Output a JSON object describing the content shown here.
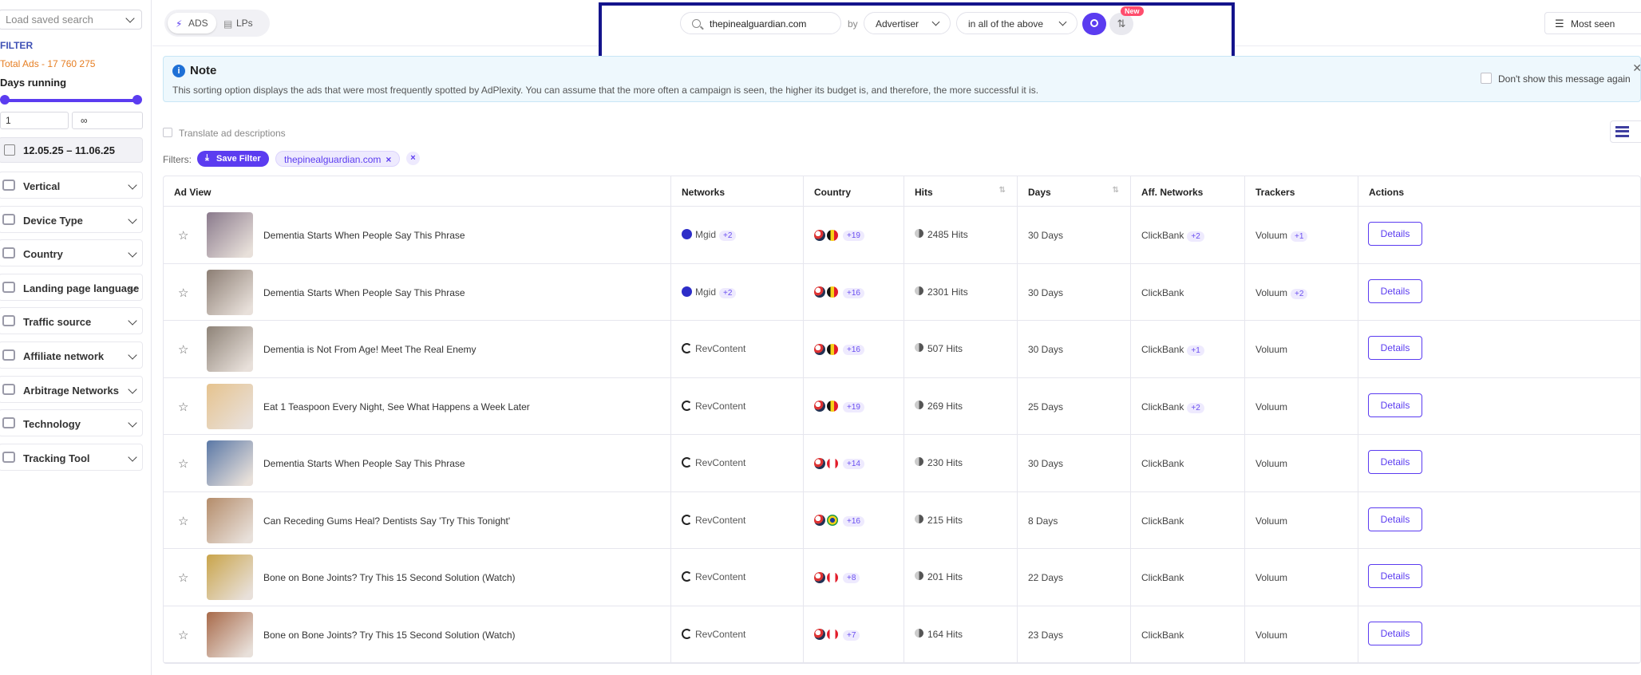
{
  "sidebar": {
    "saved_search_placeholder": "Load saved search",
    "filter_title": "FILTER",
    "total_ads": "Total Ads - 17 760 275",
    "days_running_label": "Days running",
    "days_min": "1",
    "days_max": "∞",
    "date_range": "12.05.25 – 11.06.25",
    "sections": [
      {
        "label": "Vertical",
        "icon": "vertical-icon"
      },
      {
        "label": "Device Type",
        "icon": "device-icon"
      },
      {
        "label": "Country",
        "icon": "globe-icon"
      },
      {
        "label": "Landing page language",
        "icon": "language-icon"
      },
      {
        "label": "Traffic source",
        "icon": "traffic-icon"
      },
      {
        "label": "Affiliate network",
        "icon": "affiliate-icon"
      },
      {
        "label": "Arbitrage Networks",
        "icon": "arbitrage-icon"
      },
      {
        "label": "Technology",
        "icon": "technology-icon"
      },
      {
        "label": "Tracking Tool",
        "icon": "tracking-icon"
      }
    ]
  },
  "topbar": {
    "toggle": {
      "ads": "ADS",
      "lps": "LPs"
    },
    "search_value": "thepinealguardian.com",
    "by_label": "by",
    "search_by": "Advertiser",
    "search_scope": "in all of the above",
    "new_badge": "New",
    "sort": "Most seen"
  },
  "note": {
    "title": "Note",
    "text": "This sorting option displays the ads that were most frequently spotted by AdPlexity. You can assume that the more often a campaign is seen, the higher its budget is, and therefore, the more successful it is.",
    "dont_show": "Don't show this message again"
  },
  "filters": {
    "translate_label": "Translate ad descriptions",
    "label": "Filters:",
    "save_filter": "Save Filter",
    "active": [
      "thepinealguardian.com"
    ]
  },
  "table": {
    "headers": [
      "Ad View",
      "Networks",
      "Country",
      "Hits",
      "Days",
      "Aff. Networks",
      "Trackers",
      "Actions"
    ],
    "details_label": "Details",
    "rows": [
      {
        "title": "Dementia Starts When People Say This Phrase",
        "network": "Mgid",
        "network_extra": "+2",
        "flags": [
          "us",
          "be"
        ],
        "country_extra": "+19",
        "hits": "2485 Hits",
        "days": "30 Days",
        "aff": "ClickBank",
        "aff_extra": "+2",
        "tracker": "Voluum",
        "tracker_extra": "+1",
        "thumb_color": "#8a7a8c"
      },
      {
        "title": "Dementia Starts When People Say This Phrase",
        "network": "Mgid",
        "network_extra": "+2",
        "flags": [
          "us",
          "be"
        ],
        "country_extra": "+16",
        "hits": "2301 Hits",
        "days": "30 Days",
        "aff": "ClickBank",
        "aff_extra": "",
        "tracker": "Voluum",
        "tracker_extra": "+2",
        "thumb_color": "#8c7e74"
      },
      {
        "title": "Dementia is Not From Age! Meet The Real Enemy",
        "network": "RevContent",
        "network_extra": "",
        "flags": [
          "us",
          "be"
        ],
        "country_extra": "+16",
        "hits": "507 Hits",
        "days": "30 Days",
        "aff": "ClickBank",
        "aff_extra": "+1",
        "tracker": "Voluum",
        "tracker_extra": "",
        "thumb_color": "#8e8378"
      },
      {
        "title": "Eat 1 Teaspoon Every Night, See What Happens a Week Later",
        "network": "RevContent",
        "network_extra": "",
        "flags": [
          "us",
          "be"
        ],
        "country_extra": "+19",
        "hits": "269 Hits",
        "days": "25 Days",
        "aff": "ClickBank",
        "aff_extra": "+2",
        "tracker": "Voluum",
        "tracker_extra": "",
        "thumb_color": "#e6c38e"
      },
      {
        "title": "Dementia Starts When People Say This Phrase",
        "network": "RevContent",
        "network_extra": "",
        "flags": [
          "us",
          "ca"
        ],
        "country_extra": "+14",
        "hits": "230 Hits",
        "days": "30 Days",
        "aff": "ClickBank",
        "aff_extra": "",
        "tracker": "Voluum",
        "tracker_extra": "",
        "thumb_color": "#5a78a6"
      },
      {
        "title": "Can Receding Gums Heal? Dentists Say 'Try This Tonight'",
        "network": "RevContent",
        "network_extra": "",
        "flags": [
          "us",
          "br"
        ],
        "country_extra": "+16",
        "hits": "215 Hits",
        "days": "8 Days",
        "aff": "ClickBank",
        "aff_extra": "",
        "tracker": "Voluum",
        "tracker_extra": "",
        "thumb_color": "#b48c6a"
      },
      {
        "title": "Bone on Bone Joints? Try This 15 Second Solution (Watch)",
        "network": "RevContent",
        "network_extra": "",
        "flags": [
          "us",
          "ca"
        ],
        "country_extra": "+8",
        "hits": "201 Hits",
        "days": "22 Days",
        "aff": "ClickBank",
        "aff_extra": "",
        "tracker": "Voluum",
        "tracker_extra": "",
        "thumb_color": "#c9a44a"
      },
      {
        "title": "Bone on Bone Joints? Try This 15 Second Solution (Watch)",
        "network": "RevContent",
        "network_extra": "",
        "flags": [
          "us",
          "ca"
        ],
        "country_extra": "+7",
        "hits": "164 Hits",
        "days": "23 Days",
        "aff": "ClickBank",
        "aff_extra": "",
        "tracker": "Voluum",
        "tracker_extra": "",
        "thumb_color": "#a86a4a"
      }
    ]
  },
  "colors": {
    "accent": "#5b3cf0",
    "highlight_border": "#14148c",
    "total_ads": "#e67e22"
  }
}
